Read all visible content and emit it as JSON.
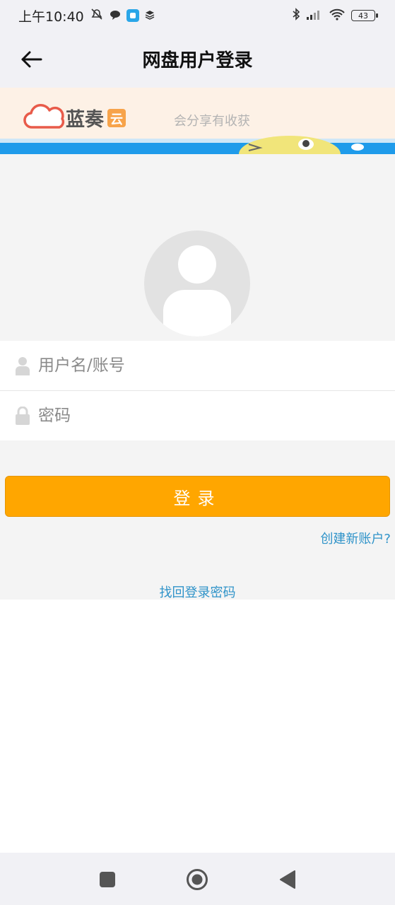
{
  "status_bar": {
    "time": "上午10:40",
    "battery": "43"
  },
  "header": {
    "title": "网盘用户登录"
  },
  "banner": {
    "brand": "蓝奏",
    "brand_badge": "云",
    "slogan": "会分享有收获"
  },
  "form": {
    "username_placeholder": "用户名/账号",
    "password_placeholder": "密码",
    "login_label": "登录",
    "create_account_label": "创建新账户?",
    "recover_password_label": "找回登录密码"
  },
  "colors": {
    "accent": "#ffa600",
    "link": "#2f93c9",
    "banner_blue": "#1f9bea"
  },
  "icons": {
    "back": "arrow-left-icon",
    "username": "person-icon",
    "password": "lock-icon"
  }
}
